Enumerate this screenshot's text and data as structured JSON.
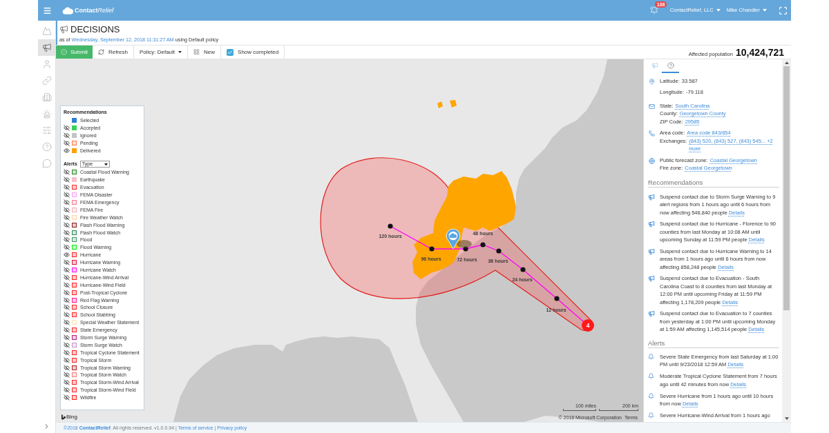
{
  "topbar": {
    "logo": {
      "part_1": "Contact",
      "part_2": "Relief"
    },
    "notification_count": "138",
    "organization": "ContactRelief, LLC",
    "user": "Mike Chandler"
  },
  "rail": {
    "items": [
      {
        "selected": false
      },
      {
        "selected": true
      },
      {
        "selected": false
      },
      {
        "selected": false
      },
      {
        "selected": false
      },
      {
        "selected": false
      },
      {
        "selected": false
      },
      {
        "selected": false
      },
      {
        "selected": false
      }
    ]
  },
  "header": {
    "title": "DECISIONS",
    "subtitle": {
      "prefix": "as of",
      "link": "Wednesday, September 12, 2018 11:31:27 AM",
      "suffix": "using Default policy"
    }
  },
  "toolbar": {
    "buttons": [
      {
        "kind": "submit",
        "label": "Submit"
      },
      {
        "kind": "refresh",
        "label": "Refresh"
      },
      {
        "kind": "dropdown",
        "label": "Policy: Default"
      },
      {
        "kind": "new",
        "label": "New"
      }
    ],
    "show_completed": {
      "label": "Show completed",
      "checked": true
    },
    "affected_population": {
      "label": "Affected population",
      "value": "10,424,721"
    }
  },
  "map": {
    "legend": {
      "recommendations": {
        "title": "Recommendations",
        "items": [
          {
            "label": "Selected",
            "color": "#2d7fd3",
            "kind": "solid"
          },
          {
            "label": "Accepted",
            "color": "#36d35a",
            "kind": "solid",
            "visible": false
          },
          {
            "label": "Ignored",
            "color": "#c4c4c4",
            "kind": "solid",
            "visible": false
          },
          {
            "label": "Pending",
            "color": "#ff7a45",
            "kind": "outline",
            "visible": false
          },
          {
            "label": "Delivered",
            "color": "#ffa000",
            "kind": "solid",
            "visible": true
          }
        ]
      },
      "alerts": {
        "title": "Alerts",
        "filter": "Type",
        "items": [
          {
            "label": "Coastal Flood Warning",
            "color": "#228b22",
            "kind": "outline",
            "visible": false
          },
          {
            "label": "Earthquake",
            "color": "#f8c0c8",
            "kind": "solid",
            "visible": false
          },
          {
            "label": "Evacuation",
            "color": "#ff2a2a",
            "kind": "outline",
            "visible": false
          },
          {
            "label": "FEMA Disaster",
            "color": "#f5a0f5",
            "kind": "outline",
            "visible": false
          },
          {
            "label": "FEMA Emergency",
            "color": "#f08090",
            "kind": "outline",
            "visible": false
          },
          {
            "label": "FEMA Fire",
            "color": "#f4b0b8",
            "kind": "outline",
            "visible": false
          },
          {
            "label": "Fire Weather Watch",
            "color": "#ffd8a8",
            "kind": "outline",
            "visible": false
          },
          {
            "label": "Flash Flood Warning",
            "color": "#8b1a1a",
            "kind": "outline",
            "visible": false
          },
          {
            "label": "Flash Flood Watch",
            "color": "#2e8b57",
            "kind": "outline",
            "visible": false
          },
          {
            "label": "Flood",
            "color": "#3a9a6a",
            "kind": "outline",
            "visible": false
          },
          {
            "label": "Flood Warning",
            "color": "#00ee00",
            "kind": "outline",
            "visible": false
          },
          {
            "label": "Hurricane",
            "color": "#ff2020",
            "kind": "outline",
            "visible": true
          },
          {
            "label": "Hurricane Warning",
            "color": "#dc143c",
            "kind": "outline",
            "visible": false
          },
          {
            "label": "Hurricane Watch",
            "color": "#ff00ff",
            "kind": "outline",
            "visible": false
          },
          {
            "label": "Hurricane-Wind Arrival",
            "color": "#ff2020",
            "kind": "outline",
            "visible": false
          },
          {
            "label": "Hurricane-Wind Field",
            "color": "#ff2020",
            "kind": "outline",
            "visible": false
          },
          {
            "label": "Post-Tropical Cyclone",
            "color": "#ff2020",
            "kind": "outline",
            "visible": false
          },
          {
            "label": "Red Flag Warning",
            "color": "#ff1493",
            "kind": "outline",
            "visible": false
          },
          {
            "label": "School Closure",
            "color": "#ff2020",
            "kind": "outline",
            "visible": false
          },
          {
            "label": "School Stabbing",
            "color": "#ff2020",
            "kind": "outline",
            "visible": false
          },
          {
            "label": "Special Weather Statement",
            "color": "#ffe4b5",
            "kind": "outline",
            "visible": false
          },
          {
            "label": "State Emergency",
            "color": "#ff2020",
            "kind": "outline",
            "visible": false
          },
          {
            "label": "Storm Surge Warning",
            "color": "#b5247c",
            "kind": "outline",
            "visible": false
          },
          {
            "label": "Storm Surge Watch",
            "color": "#c896c8",
            "kind": "outline",
            "visible": false
          },
          {
            "label": "Tropical Cyclone Statement",
            "color": "#ff2020",
            "kind": "outline",
            "visible": false
          },
          {
            "label": "Tropical Storm",
            "color": "#ff2020",
            "kind": "outline",
            "visible": false
          },
          {
            "label": "Tropical Storm Warning",
            "color": "#b22222",
            "kind": "outline",
            "visible": false
          },
          {
            "label": "Tropical Storm Watch",
            "color": "#f08080",
            "kind": "outline",
            "visible": false
          },
          {
            "label": "Tropical Storm-Wind Arrival",
            "color": "#ff2020",
            "kind": "outline",
            "visible": false
          },
          {
            "label": "Tropical Storm-Wind Field",
            "color": "#ff2020",
            "kind": "outline",
            "visible": false
          },
          {
            "label": "Wildfire",
            "color": "#ff2020",
            "kind": "outline",
            "visible": false
          }
        ]
      }
    },
    "track_labels": [
      "120 hours",
      "96 hours",
      "72 hours",
      "48 hours",
      "36 hours",
      "24 hours",
      "12 hours"
    ],
    "storm": {
      "category": "4"
    },
    "attribution": {
      "logo": "Bing",
      "scale": [
        "100 miles",
        "200 km"
      ],
      "copyright": "© 2018 Microsoft Corporation",
      "terms": "Terms"
    }
  },
  "side_panel": {
    "tabs": [
      {
        "selected": false
      },
      {
        "selected": true
      }
    ],
    "details": [
      {
        "kind": "location",
        "fields": [
          {
            "label": "Latitude:",
            "value": "33.587"
          },
          {
            "label": "Longitude:",
            "value": "-79.118"
          }
        ]
      },
      {
        "kind": "address",
        "fields": [
          {
            "label": "State:",
            "link": "South Carolina"
          },
          {
            "label": "County:",
            "link": "Georgetown County"
          },
          {
            "label": "ZIP Code:",
            "link": "29585"
          }
        ]
      },
      {
        "kind": "phone",
        "fields": [
          {
            "label": "Area code:",
            "link": "Area code 843/854"
          },
          {
            "label": "Exchanges:",
            "link": "(843) 520, (843) 527, (843) 545... +2 more"
          }
        ]
      },
      {
        "kind": "zone",
        "fields": [
          {
            "label": "Public forecast zone:",
            "link": "Coastal Georgetown"
          },
          {
            "label": "Fire zone:",
            "link": "Coastal Georgetown"
          }
        ]
      }
    ],
    "recommendations": {
      "title": "Recommendations",
      "items": [
        {
          "text": "Suspend contact due to Storm Surge Warning to 9 alert regions from 1 hours ago until 6 hours from now affecting 546,840 people",
          "link": "Details"
        },
        {
          "text": "Suspend contact due to Hurricane - Florence to 90 counties from last Monday at 10:08 AM until upcoming Sunday at 11:59 PM people",
          "link": "Details"
        },
        {
          "text": "Suspend contact due to Hurricane Warning to 14 areas from 1 hours ago until 6 hours from now affecting 858,248 people",
          "link": "Details"
        },
        {
          "text": "Suspend contact due to Evacuation - South Carolina Coast to 8 counties from last Monday at 12:00 PM until upcoming Friday at 11:59 PM affecting 1,178,209 people",
          "link": "Details"
        },
        {
          "text": "Suspend contact due to Evacuation to 7 counties from yesterday at 1:00 PM until upcoming Monday at 1:59 AM affecting 1,145,514 people",
          "link": "Details"
        }
      ]
    },
    "alerts": {
      "title": "Alerts",
      "items": [
        {
          "text": "Severe State Emergency from last Saturday at 1:00 PM until 9/23/2018 12:59 AM",
          "link": "Details"
        },
        {
          "text": "Moderate Tropical Cyclone Statement from 7 hours ago until 42 minutes from now",
          "link": "Details"
        },
        {
          "text": "Severe Hurricane from 1 hours ago until 10 hours from now",
          "link": "Details"
        },
        {
          "text": "Severe Hurricane-Wind Arrival from 1 hours ago"
        }
      ]
    }
  },
  "footer": {
    "year": "©2018",
    "brand": "ContactRelief",
    "rights": ". All rights reserved. v1.0.0.94",
    "separator": "|",
    "links": [
      "Terms of service",
      "Privacy policy"
    ]
  }
}
